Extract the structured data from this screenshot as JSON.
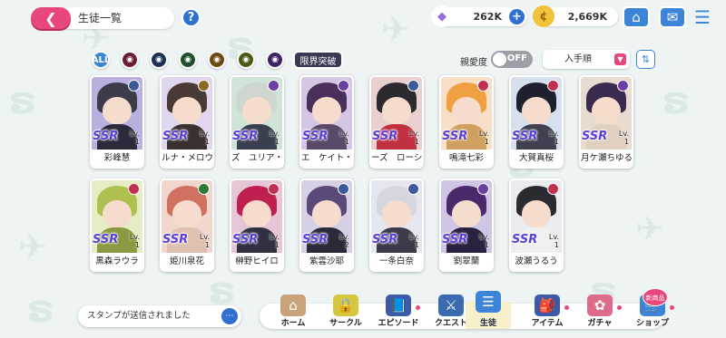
{
  "header": {
    "back_icon": "chevron-left-icon",
    "title": "生徒一覧",
    "help_label": "?",
    "gems": {
      "value": "262K",
      "icon": "gem-icon",
      "plus": "+"
    },
    "coins": {
      "value": "2,669K",
      "icon": "coin-icon"
    },
    "icons": [
      "home-icon",
      "mail-icon",
      "menu-icon"
    ]
  },
  "filters": {
    "all_label": "ALL",
    "elements": [
      {
        "name": "element-filter-1",
        "color": "#6a1e33"
      },
      {
        "name": "element-filter-2",
        "color": "#1e2f55"
      },
      {
        "name": "element-filter-3",
        "color": "#1f4f2a"
      },
      {
        "name": "element-filter-4",
        "color": "#6a4a10"
      },
      {
        "name": "element-filter-5",
        "color": "#4b5a12"
      },
      {
        "name": "element-filter-6",
        "color": "#3e2266"
      }
    ],
    "limit_break_label": "限界突破",
    "affection_label": "親愛度",
    "toggle_state": "OFF",
    "sort_label": "入手順",
    "sort_arrow": "▼",
    "order_icon": "sort-order-icon"
  },
  "students": [
    {
      "name": "彩峰慧",
      "level": "1",
      "rarity": "SSR",
      "hair": "#3b3b4a",
      "body": "#2a2a3a",
      "bg": "#b9b0e0",
      "elem": "#3b5a99"
    },
    {
      "name": "ルナ・メロウ",
      "level": "1",
      "rarity": "SSR",
      "hair": "#4a3a35",
      "body": "#3a3030",
      "bg": "#e0d6ee",
      "elem": "#8a6a20"
    },
    {
      "name": "ズ　ユリア・",
      "level": "1",
      "rarity": "SSR",
      "hair": "#cfd6cf",
      "body": "#3a3f50",
      "bg": "#cfe3d6",
      "elem": "#6a3fa0"
    },
    {
      "name": "エ　ケイト・",
      "level": "1",
      "rarity": "SSR",
      "hair": "#4a2f5a",
      "body": "#5a4a6a",
      "bg": "#d6c6e6",
      "elem": "#6a3fa0"
    },
    {
      "name": "ーズ　ローシ",
      "level": "1",
      "rarity": "SSR",
      "hair": "#2a2a30",
      "body": "#c03040",
      "bg": "#e8d0d0",
      "elem": "#3b5a99"
    },
    {
      "name": "鳴滝七彩",
      "level": "1",
      "rarity": "SSR",
      "hair": "#f0a040",
      "body": "#d0a060",
      "bg": "#f8e0c8",
      "elem": "#c03050"
    },
    {
      "name": "大賀真桜",
      "level": "1",
      "rarity": "SSR",
      "hair": "#1e2030",
      "body": "#404050",
      "bg": "#d6e0ee",
      "elem": "#c03050"
    },
    {
      "name": "月ケ瀬ちゆる",
      "level": "1",
      "rarity": "SSR",
      "hair": "#3a2a50",
      "body": "#e0d0c0",
      "bg": "#e6dcd0",
      "elem": "#6a3fa0"
    },
    {
      "name": "黒森ラウラ",
      "level": "1",
      "rarity": "SSR",
      "hair": "#b0c050",
      "body": "#8a9a40",
      "bg": "#e6ecc6",
      "elem": "#c03050"
    },
    {
      "name": "姫川泉花",
      "level": "1",
      "rarity": "SSR",
      "hair": "#d07060",
      "body": "#e0c0b0",
      "bg": "#f0d6cc",
      "elem": "#2f7a3a"
    },
    {
      "name": "榊野ヒイロ",
      "level": "1",
      "rarity": "SSR",
      "hair": "#c02050",
      "body": "#303040",
      "bg": "#e6c6d6",
      "elem": "#c03050"
    },
    {
      "name": "紫雲沙耶",
      "level": "2",
      "rarity": "SSR",
      "hair": "#5a4a7a",
      "body": "#2a2a3a",
      "bg": "#d6d0e6",
      "elem": "#3b5a99"
    },
    {
      "name": "一条白奈",
      "level": "1",
      "rarity": "SSR",
      "hair": "#d6d6e0",
      "body": "#3a3a48",
      "bg": "#e6e6ee",
      "elem": "#3b5a99"
    },
    {
      "name": "劉翠蘭",
      "level": "1",
      "rarity": "SSR",
      "hair": "#4a2a6a",
      "body": "#2a2040",
      "bg": "#cfc6e6",
      "elem": "#6a3fa0"
    },
    {
      "name": "波瀬うるう",
      "level": "1",
      "rarity": "SSR",
      "hair": "#2a2a30",
      "body": "#f0f0f0",
      "bg": "#ececf0",
      "elem": "#c03050"
    }
  ],
  "card_level_prefix": "Lv.",
  "stamp_notice": "スタンプが送信されました",
  "nav": [
    {
      "label": "ホーム",
      "icon": "home-nav-icon",
      "color": "#c9a27a"
    },
    {
      "label": "サークル",
      "icon": "circle-lock-icon",
      "color": "#d6c640"
    },
    {
      "label": "エピソード",
      "icon": "book-icon",
      "color": "#3d5aa8"
    },
    {
      "label": "クエスト",
      "icon": "sword-icon",
      "color": "#3a6ab0"
    },
    {
      "label": "生徒",
      "icon": "student-icon",
      "color": "#3d83d8"
    },
    {
      "label": "アイテム",
      "icon": "bag-icon",
      "color": "#3d5aa8"
    },
    {
      "label": "ガチャ",
      "icon": "gacha-icon",
      "color": "#e06a8a"
    },
    {
      "label": "ショップ",
      "icon": "shop-icon",
      "color": "#3d83d8"
    }
  ],
  "new_badge": "新商品"
}
